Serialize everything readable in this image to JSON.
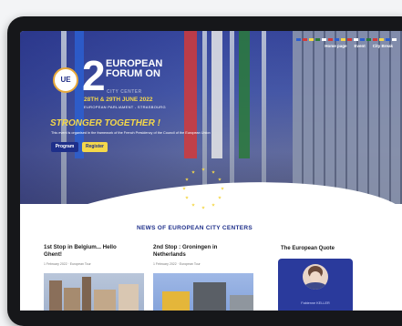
{
  "nav": {
    "items": [
      "Home page",
      "Event",
      "City Break"
    ]
  },
  "hero": {
    "logo_text": "UE",
    "big_number": "2",
    "title_line1": "EUROPEAN",
    "title_line2": "FORUM ON",
    "subtitle": "CITY CENTER",
    "dates": "28TH & 29TH JUNE 2022",
    "location": "EUROPEAN PARLIAMENT - STRASBOURG",
    "slogan": "STRONGER TOGETHER !",
    "description": "This event is organised in the framework of the French Presidency of the Council of the European Union",
    "program_label": "Program",
    "register_label": "Register"
  },
  "news": {
    "heading": "NEWS OF EUROPEAN CITY CENTERS",
    "cards": [
      {
        "title": "1st Stop in Belgium... Hello Ghent!",
        "meta": "1 February 2022 · European Tour"
      },
      {
        "title": "2nd Stop : Groningen in Netherlands",
        "meta": "1 February 2022 · European Tour"
      }
    ]
  },
  "quote": {
    "title": "The European Quote",
    "person_name": "Fabienne KELLER"
  },
  "colors": {
    "brand_blue": "#1e2f8a",
    "accent_yellow": "#f5d84a"
  }
}
